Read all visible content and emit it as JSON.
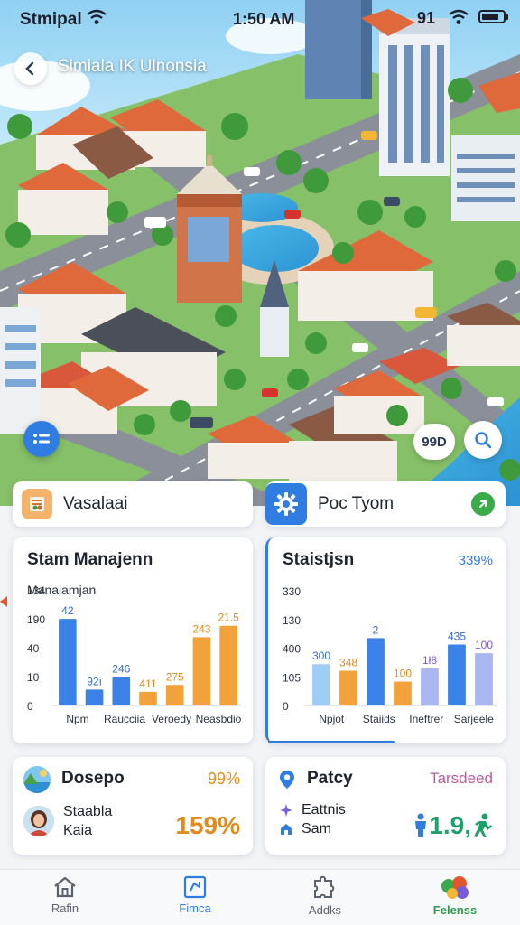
{
  "status_bar": {
    "carrier": "Stmipal",
    "time": "1:50 AM",
    "right_label": "91"
  },
  "map": {
    "title": "Simiala IK Ulnonsia",
    "badge": "99D",
    "icons": {
      "back": "chevron-left-icon",
      "layers": "list-icon",
      "search": "search-icon"
    }
  },
  "quick_actions": [
    {
      "label": "Vasalaai",
      "icon": "book-icon"
    },
    {
      "label": "Poc Tyom",
      "icon": "gear-icon"
    }
  ],
  "chart_left": {
    "title": "Stam Manajenn",
    "subtitle": "Manaiamjan"
  },
  "chart_right": {
    "title": "Staistjsn",
    "percent": "339%"
  },
  "chart_data": [
    {
      "type": "bar",
      "title": "Stam Manajenn",
      "subtitle": "Manaiamjan",
      "y_tick_labels": [
        "134",
        "190",
        "40",
        "10",
        "0"
      ],
      "categories": [
        "Npm",
        "Raucciia",
        "Veroedy",
        "Neasbdio"
      ],
      "series": [
        {
          "color": "#3b82e8",
          "values": [
            190,
            35,
            60
          ]
        },
        {
          "color": "#f2a23a",
          "values": [
            30,
            30,
            175
          ]
        }
      ],
      "data_labels": [
        "42",
        "92ı",
        "246",
        "411",
        "275",
        "243",
        "21.5"
      ],
      "bars": [
        {
          "value": 190,
          "color": "#3b82e8",
          "label": "42"
        },
        {
          "value": 35,
          "color": "#3b82e8",
          "label": "92ı"
        },
        {
          "value": 62,
          "color": "#3b82e8",
          "label": "246"
        },
        {
          "value": 30,
          "color": "#f2a23a",
          "label": "411"
        },
        {
          "value": 45,
          "color": "#f2a23a",
          "label": "275"
        },
        {
          "value": 150,
          "color": "#f2a23a",
          "label": "243"
        },
        {
          "value": 175,
          "color": "#f2a23a",
          "label": "21.5"
        }
      ],
      "ylim": [
        0,
        220
      ]
    },
    {
      "type": "bar",
      "title": "Staistjsn",
      "percent_label": "339%",
      "y_tick_labels": [
        "330",
        "130",
        "400",
        "105",
        "0"
      ],
      "categories": [
        "Npjot",
        "Staiids",
        "Ineftrer",
        "Sarjeele"
      ],
      "bars": [
        {
          "value": 95,
          "color": "#9fcdf5",
          "label": "300"
        },
        {
          "value": 80,
          "color": "#f2a23a",
          "label": "348"
        },
        {
          "value": 155,
          "color": "#3b82e8",
          "label": "2"
        },
        {
          "value": 55,
          "color": "#f2a23a",
          "label": "100"
        },
        {
          "value": 85,
          "color": "#a9b6f0",
          "label": "1ł8"
        },
        {
          "value": 140,
          "color": "#3b82e8",
          "label": "435"
        },
        {
          "value": 120,
          "color": "#a9b6f0",
          "label": "100"
        }
      ],
      "ylim": [
        0,
        220
      ]
    }
  ],
  "stat_left": {
    "title": "Dosepo",
    "percent": "99%",
    "line1": "Staabla",
    "line2": "Kaia",
    "big": "159%"
  },
  "stat_right": {
    "title": "Patcy",
    "tag": "Tarsdeed",
    "line1": "Eattnis",
    "line2": "Sam",
    "big": "1.9,"
  },
  "nav": [
    {
      "label": "Rafin",
      "icon": "home-icon"
    },
    {
      "label": "Fimca",
      "icon": "map-icon"
    },
    {
      "label": "Addks",
      "icon": "puzzle-icon"
    },
    {
      "label": "Felenss",
      "icon": "apps-icon"
    }
  ],
  "colors": {
    "accent": "#2f7de1",
    "orange": "#e38a1e",
    "green": "#1fa06a",
    "pink": "#b85aa0"
  }
}
